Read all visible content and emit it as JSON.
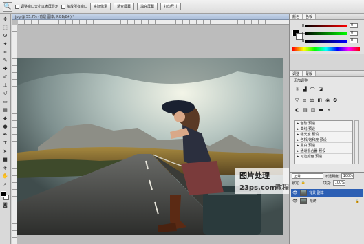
{
  "options_bar": {
    "checks": [
      "调整窗口大小以满屏显示",
      "缩放所有窗口"
    ],
    "buttons": [
      "实际像素",
      "适合屏幕",
      "填充屏幕",
      "打印尺寸"
    ]
  },
  "document": {
    "title": "jpg @ 55.7% (背景 副本, RGB/8#) *",
    "photo_description_icon": "road-trip-photo"
  },
  "color_panel": {
    "tabs": [
      "颜色",
      "色板"
    ],
    "r": "0",
    "g": "0",
    "b": "0"
  },
  "adjustments": {
    "tabs": [
      "调整",
      "蒙版"
    ],
    "heading": "添加调整",
    "presets": [
      "色阶 预设",
      "曲线 预设",
      "曝光度 预设",
      "色相/饱和度 预设",
      "黑白 预设",
      "通道混合器 预设",
      "可选颜色 预设"
    ]
  },
  "layers": {
    "blend_mode": "正常",
    "opacity_label": "不透明度:",
    "opacity": "100%",
    "lock_label": "锁定:",
    "fill_label": "填充:",
    "fill": "100%",
    "items": [
      {
        "name": "背景 副本",
        "selected": true
      },
      {
        "name": "背景",
        "selected": false
      }
    ]
  },
  "watermark": {
    "line1": "图片处理",
    "line2": "23ps.com",
    "line3": "教程网"
  },
  "colors": {
    "selection": "#2c5fb4",
    "accent": "#e6a020"
  }
}
